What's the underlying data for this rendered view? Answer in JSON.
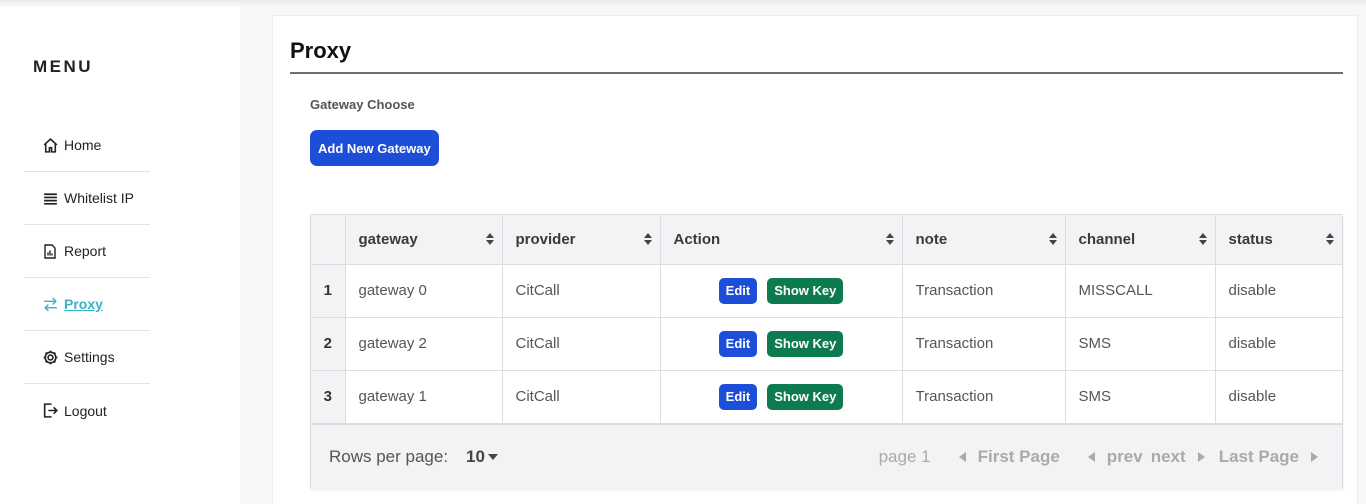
{
  "sidebar": {
    "menu_title": "MENU",
    "items": [
      {
        "label": "Home",
        "icon": "home-icon"
      },
      {
        "label": "Whitelist IP",
        "icon": "list-icon"
      },
      {
        "label": "Report",
        "icon": "report-icon"
      },
      {
        "label": "Proxy",
        "icon": "swap-icon",
        "active": true
      },
      {
        "label": "Settings",
        "icon": "gear-icon"
      },
      {
        "label": "Logout",
        "icon": "logout-icon"
      }
    ],
    "active_color": "#39b3c9"
  },
  "main": {
    "title": "Proxy",
    "gateway_choose_label": "Gateway Choose",
    "add_button_label": "Add New Gateway",
    "accent_color": "#1d4ed8"
  },
  "table": {
    "columns": [
      "gateway",
      "provider",
      "Action",
      "note",
      "channel",
      "status"
    ],
    "rows": [
      {
        "index": "1",
        "gateway": "gateway 0",
        "provider": "CitCall",
        "note": "Transaction",
        "channel": "MISSCALL",
        "status": "disable"
      },
      {
        "index": "2",
        "gateway": "gateway 2",
        "provider": "CitCall",
        "note": "Transaction",
        "channel": "SMS",
        "status": "disable"
      },
      {
        "index": "3",
        "gateway": "gateway 1",
        "provider": "CitCall",
        "note": "Transaction",
        "channel": "SMS",
        "status": "disable"
      }
    ],
    "edit_label": "Edit",
    "show_key_label": "Show Key",
    "edit_color": "#1d4ed8",
    "show_key_color": "#0e7a4f"
  },
  "pagination": {
    "rows_per_page_label": "Rows per page:",
    "rows_per_page_value": "10",
    "page_label": "page 1",
    "first_page": "First Page",
    "prev": "prev",
    "next": "next",
    "last_page": "Last Page"
  }
}
